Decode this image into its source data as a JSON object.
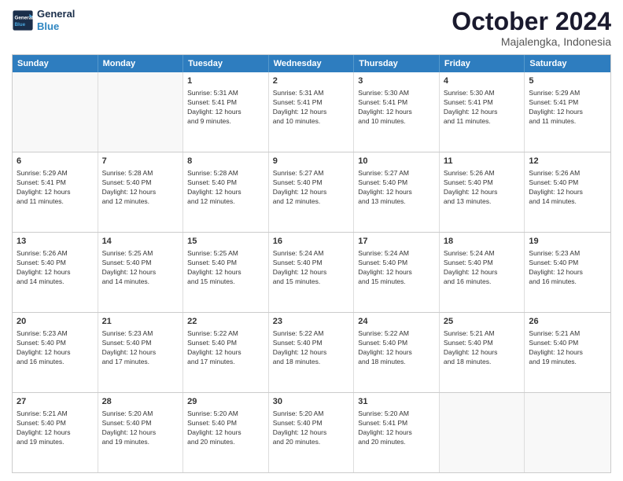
{
  "logo": {
    "line1": "General",
    "line2": "Blue"
  },
  "title": "October 2024",
  "subtitle": "Majalengka, Indonesia",
  "days": [
    "Sunday",
    "Monday",
    "Tuesday",
    "Wednesday",
    "Thursday",
    "Friday",
    "Saturday"
  ],
  "weeks": [
    [
      {
        "day": "",
        "info": ""
      },
      {
        "day": "",
        "info": ""
      },
      {
        "day": "1",
        "info": "Sunrise: 5:31 AM\nSunset: 5:41 PM\nDaylight: 12 hours\nand 9 minutes."
      },
      {
        "day": "2",
        "info": "Sunrise: 5:31 AM\nSunset: 5:41 PM\nDaylight: 12 hours\nand 10 minutes."
      },
      {
        "day": "3",
        "info": "Sunrise: 5:30 AM\nSunset: 5:41 PM\nDaylight: 12 hours\nand 10 minutes."
      },
      {
        "day": "4",
        "info": "Sunrise: 5:30 AM\nSunset: 5:41 PM\nDaylight: 12 hours\nand 11 minutes."
      },
      {
        "day": "5",
        "info": "Sunrise: 5:29 AM\nSunset: 5:41 PM\nDaylight: 12 hours\nand 11 minutes."
      }
    ],
    [
      {
        "day": "6",
        "info": "Sunrise: 5:29 AM\nSunset: 5:41 PM\nDaylight: 12 hours\nand 11 minutes."
      },
      {
        "day": "7",
        "info": "Sunrise: 5:28 AM\nSunset: 5:40 PM\nDaylight: 12 hours\nand 12 minutes."
      },
      {
        "day": "8",
        "info": "Sunrise: 5:28 AM\nSunset: 5:40 PM\nDaylight: 12 hours\nand 12 minutes."
      },
      {
        "day": "9",
        "info": "Sunrise: 5:27 AM\nSunset: 5:40 PM\nDaylight: 12 hours\nand 12 minutes."
      },
      {
        "day": "10",
        "info": "Sunrise: 5:27 AM\nSunset: 5:40 PM\nDaylight: 12 hours\nand 13 minutes."
      },
      {
        "day": "11",
        "info": "Sunrise: 5:26 AM\nSunset: 5:40 PM\nDaylight: 12 hours\nand 13 minutes."
      },
      {
        "day": "12",
        "info": "Sunrise: 5:26 AM\nSunset: 5:40 PM\nDaylight: 12 hours\nand 14 minutes."
      }
    ],
    [
      {
        "day": "13",
        "info": "Sunrise: 5:26 AM\nSunset: 5:40 PM\nDaylight: 12 hours\nand 14 minutes."
      },
      {
        "day": "14",
        "info": "Sunrise: 5:25 AM\nSunset: 5:40 PM\nDaylight: 12 hours\nand 14 minutes."
      },
      {
        "day": "15",
        "info": "Sunrise: 5:25 AM\nSunset: 5:40 PM\nDaylight: 12 hours\nand 15 minutes."
      },
      {
        "day": "16",
        "info": "Sunrise: 5:24 AM\nSunset: 5:40 PM\nDaylight: 12 hours\nand 15 minutes."
      },
      {
        "day": "17",
        "info": "Sunrise: 5:24 AM\nSunset: 5:40 PM\nDaylight: 12 hours\nand 15 minutes."
      },
      {
        "day": "18",
        "info": "Sunrise: 5:24 AM\nSunset: 5:40 PM\nDaylight: 12 hours\nand 16 minutes."
      },
      {
        "day": "19",
        "info": "Sunrise: 5:23 AM\nSunset: 5:40 PM\nDaylight: 12 hours\nand 16 minutes."
      }
    ],
    [
      {
        "day": "20",
        "info": "Sunrise: 5:23 AM\nSunset: 5:40 PM\nDaylight: 12 hours\nand 16 minutes."
      },
      {
        "day": "21",
        "info": "Sunrise: 5:23 AM\nSunset: 5:40 PM\nDaylight: 12 hours\nand 17 minutes."
      },
      {
        "day": "22",
        "info": "Sunrise: 5:22 AM\nSunset: 5:40 PM\nDaylight: 12 hours\nand 17 minutes."
      },
      {
        "day": "23",
        "info": "Sunrise: 5:22 AM\nSunset: 5:40 PM\nDaylight: 12 hours\nand 18 minutes."
      },
      {
        "day": "24",
        "info": "Sunrise: 5:22 AM\nSunset: 5:40 PM\nDaylight: 12 hours\nand 18 minutes."
      },
      {
        "day": "25",
        "info": "Sunrise: 5:21 AM\nSunset: 5:40 PM\nDaylight: 12 hours\nand 18 minutes."
      },
      {
        "day": "26",
        "info": "Sunrise: 5:21 AM\nSunset: 5:40 PM\nDaylight: 12 hours\nand 19 minutes."
      }
    ],
    [
      {
        "day": "27",
        "info": "Sunrise: 5:21 AM\nSunset: 5:40 PM\nDaylight: 12 hours\nand 19 minutes."
      },
      {
        "day": "28",
        "info": "Sunrise: 5:20 AM\nSunset: 5:40 PM\nDaylight: 12 hours\nand 19 minutes."
      },
      {
        "day": "29",
        "info": "Sunrise: 5:20 AM\nSunset: 5:40 PM\nDaylight: 12 hours\nand 20 minutes."
      },
      {
        "day": "30",
        "info": "Sunrise: 5:20 AM\nSunset: 5:40 PM\nDaylight: 12 hours\nand 20 minutes."
      },
      {
        "day": "31",
        "info": "Sunrise: 5:20 AM\nSunset: 5:41 PM\nDaylight: 12 hours\nand 20 minutes."
      },
      {
        "day": "",
        "info": ""
      },
      {
        "day": "",
        "info": ""
      }
    ]
  ]
}
